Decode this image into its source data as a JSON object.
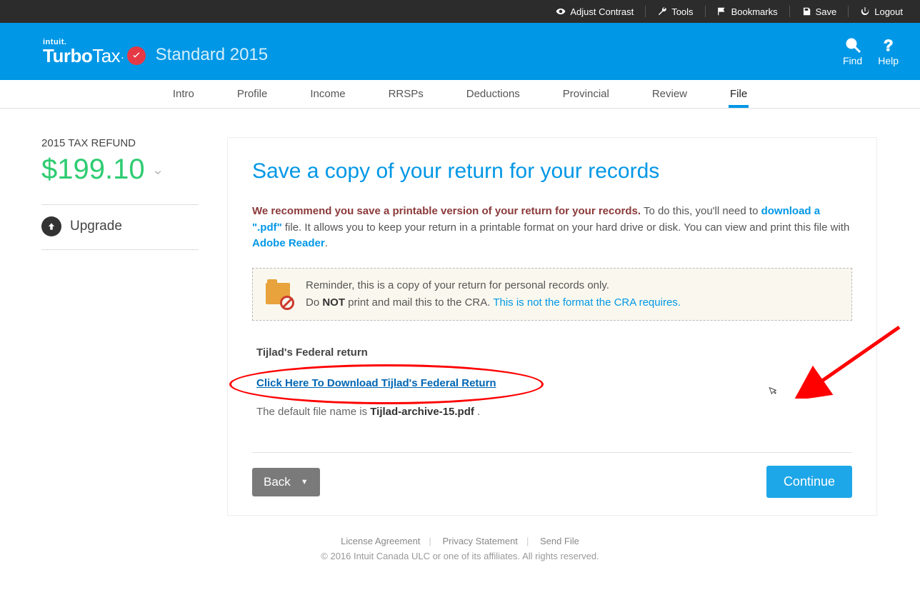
{
  "topbar": {
    "contrast": "Adjust Contrast",
    "tools": "Tools",
    "bookmarks": "Bookmarks",
    "save": "Save",
    "logout": "Logout"
  },
  "brand": {
    "intuit": "intuit.",
    "turbo": "Turbo",
    "tax": "Tax",
    "dot": ".",
    "sub": "Standard 2015"
  },
  "headerActions": {
    "find": "Find",
    "help": "Help"
  },
  "nav": {
    "items": [
      "Intro",
      "Profile",
      "Income",
      "RRSPs",
      "Deductions",
      "Provincial",
      "Review",
      "File"
    ],
    "activeIndex": 7
  },
  "sidebar": {
    "refundLabel": "2015 TAX REFUND",
    "refundAmount": "$199.10",
    "upgrade": "Upgrade"
  },
  "main": {
    "title": "Save a copy of your return for your records",
    "recBold": "We recommend you save a printable version of your return for your records.",
    "recTail1": " To do this, you'll need to ",
    "recLinkPdf": "download a \".pdf\"",
    "recTail2": " file. It allows you to keep your return in a printable format on your hard drive or disk. You can view and print this file with ",
    "recLinkAdobe": "Adobe Reader",
    "recTail3": ".",
    "reminder1": "Reminder, this is a copy of your return for personal records only.",
    "reminder2a": "Do ",
    "reminder2b": "NOT",
    "reminder2c": " print and mail this to the CRA. ",
    "reminderLink": "This is not the format the CRA requires.",
    "sectionTitle": "Tijlad's Federal return",
    "downloadLink": "Click Here To Download Tijlad's Federal Return",
    "defaultPre": "The default file name is ",
    "defaultFile": "Tijlad-archive-15.pdf",
    "defaultPost": " .",
    "back": "Back",
    "continue": "Continue"
  },
  "footer": {
    "license": "License Agreement",
    "privacy": "Privacy Statement",
    "send": "Send File",
    "copy": "© 2016 Intuit Canada ULC or one of its affiliates. All rights reserved."
  }
}
